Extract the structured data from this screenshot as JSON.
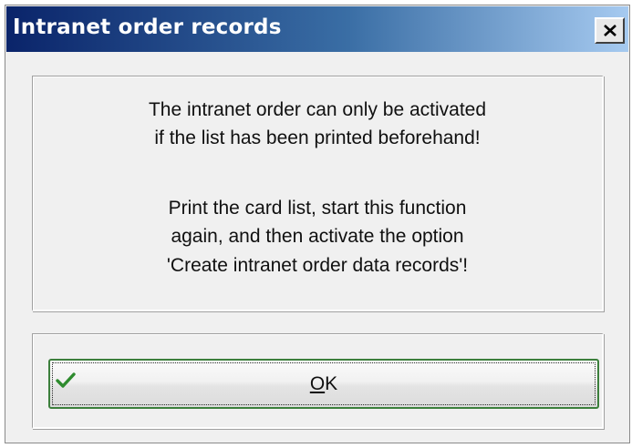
{
  "window": {
    "title": "Intranet order records"
  },
  "message": {
    "lines": [
      "The intranet order can only be activated",
      "if the list has been printed beforehand!",
      "",
      "Print the card list, start this function",
      "again, and then activate the option",
      "'Create intranet order data records'!"
    ]
  },
  "buttons": {
    "ok": {
      "mnemonic": "O",
      "rest": "K",
      "icon": "check-icon"
    },
    "close_icon": "close-icon"
  },
  "colors": {
    "titlebar_start": "#0a246a",
    "titlebar_end": "#a6caf0",
    "check_green": "#2e8b2e",
    "button_border": "#3c7f3c"
  }
}
